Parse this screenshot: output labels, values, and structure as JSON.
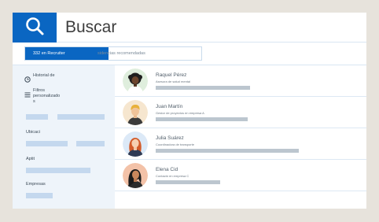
{
  "header": {
    "title": "Buscar"
  },
  "filter": {
    "chip_label": "332 en Recruiter",
    "text": "sidencias recomendadas"
  },
  "sidebar": {
    "history_label": "Historial de",
    "filters_label_1": "Filtros",
    "filters_label_2": "personalizado",
    "filters_label_3": "s",
    "location_label": "Ubicaci",
    "skills_label": "Aptit",
    "companies_label": "Empresas"
  },
  "results": [
    {
      "name": "Raquel Pérez",
      "role": "Asesora de salud mental",
      "avatar": "woman-dark-curly-hair"
    },
    {
      "name": "Juan Martín",
      "role": "Gestor de proyectos en empresa A",
      "avatar": "man-blond-hair"
    },
    {
      "name": "Julia Suárez",
      "role": "Coordinadora de transporte",
      "avatar": "woman-red-hair"
    },
    {
      "name": "Elena Cid",
      "role": "Contactó en empresa C",
      "avatar": "woman-dark-hair"
    }
  ],
  "colors": {
    "accent": "#0a66c2",
    "sidebar_bg": "#eef4fa",
    "page_bg": "#e7e3dc"
  }
}
